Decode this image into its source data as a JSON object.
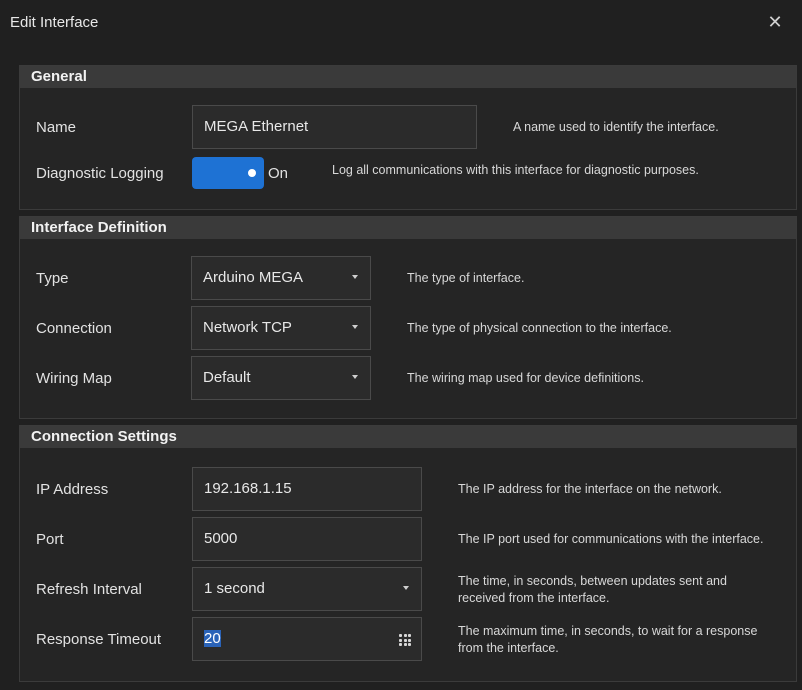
{
  "window": {
    "title": "Edit Interface"
  },
  "general": {
    "header": "General",
    "name": {
      "label": "Name",
      "value": "MEGA Ethernet",
      "desc": "A name used to identify the interface."
    },
    "logging": {
      "label": "Diagnostic Logging",
      "state": "On",
      "desc": "Log all communications with this interface for diagnostic purposes."
    }
  },
  "definition": {
    "header": "Interface Definition",
    "type": {
      "label": "Type",
      "value": "Arduino MEGA",
      "desc": "The type of interface."
    },
    "connection": {
      "label": "Connection",
      "value": "Network TCP",
      "desc": "The type of physical connection to the interface."
    },
    "wiring": {
      "label": "Wiring Map",
      "value": "Default",
      "desc": "The wiring map used for device definitions."
    }
  },
  "connection": {
    "header": "Connection Settings",
    "ip": {
      "label": "IP Address",
      "value": "192.168.1.15",
      "desc": "The IP address for the interface on the network."
    },
    "port": {
      "label": "Port",
      "value": "5000",
      "desc": "The IP port used for communications with the interface."
    },
    "refresh": {
      "label": "Refresh Interval",
      "value": "1 second",
      "desc_1": "The time, in seconds, between updates sent and",
      "desc_2": "received from the interface."
    },
    "timeout": {
      "label": "Response Timeout",
      "value": "20",
      "desc_1": "The maximum time, in seconds, to wait for a response",
      "desc_2": "from the interface."
    }
  },
  "colors": {
    "accent": "#1e72d4",
    "selection": "#2a63b8"
  }
}
